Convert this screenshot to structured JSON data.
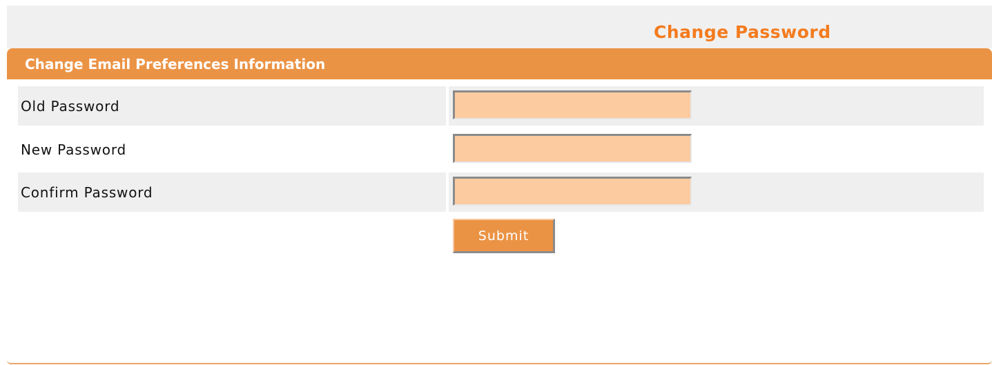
{
  "header": {
    "page_title": "Change Password"
  },
  "section": {
    "title": "Change Email Preferences Information"
  },
  "form": {
    "fields": [
      {
        "label": "Old Password",
        "value": "",
        "placeholder": ""
      },
      {
        "label": "New Password",
        "value": "",
        "placeholder": ""
      },
      {
        "label": "Confirm Password",
        "value": "",
        "placeholder": ""
      }
    ],
    "submit_label": "Submit"
  },
  "colors": {
    "accent": "#eb9345",
    "title": "#f47b1e",
    "input_background": "#fdcba0",
    "row_shade": "#efefef"
  }
}
